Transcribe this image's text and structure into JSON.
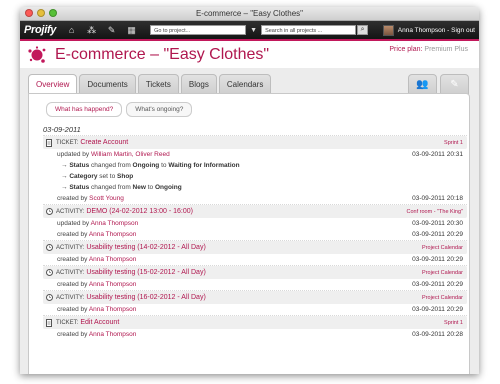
{
  "window": {
    "title": "E-commerce – \"Easy Clothes\""
  },
  "topnav": {
    "logo": "Projify",
    "goto_placeholder": "Go to project...",
    "search_placeholder": "Search in all projects ...",
    "user_name": "Anna Thompson",
    "signout": "Sign out"
  },
  "header": {
    "project_title": "E-commerce – \"Easy Clothes\"",
    "price_label": "Price plan:",
    "price_plan": "Premium Plus"
  },
  "tabs": [
    "Overview",
    "Documents",
    "Tickets",
    "Blogs",
    "Calendars"
  ],
  "subtabs": [
    "What has happend?",
    "What's ongoing?"
  ],
  "feed": {
    "date": "03-09-2011",
    "items": [
      {
        "kind": "TICKET:",
        "title": "Create Account",
        "badge": "Sprint 1",
        "rows": [
          {
            "pre": "updated by ",
            "link": "William Martin, Oliver Reed",
            "ts": "03-09-2011 20:31"
          },
          {
            "change": true,
            "arrow": "→",
            "b1": "Status",
            "t1": " changed from ",
            "b2": "Ongoing",
            "t2": " to ",
            "b3": "Waiting for Information"
          },
          {
            "change": true,
            "arrow": "→",
            "b1": "Category",
            "t1": " set to ",
            "b2": "Shop"
          },
          {
            "change": true,
            "arrow": "→",
            "b1": "Status",
            "t1": " changed from ",
            "b2": "New",
            "t2": " to ",
            "b3": "Ongoing"
          },
          {
            "pre": "created by ",
            "link": "Scott Young",
            "ts": "03-09-2011 20:18"
          }
        ]
      },
      {
        "kind": "ACTIVITY:",
        "title": "DEMO (24-02-2012 13:00 - 16:00)",
        "badge": "Conf room - \"The King\"",
        "rows": [
          {
            "pre": "updated by ",
            "link": "Anna Thompson",
            "ts": "03-09-2011 20:30"
          },
          {
            "pre": "created by ",
            "link": "Anna Thompson",
            "ts": "03-09-2011 20:29"
          }
        ]
      },
      {
        "kind": "ACTIVITY:",
        "title": "Usability testing (14-02-2012 - All Day)",
        "badge": "Project Calendar",
        "rows": [
          {
            "pre": "created by ",
            "link": "Anna Thompson",
            "ts": "03-09-2011 20:29"
          }
        ]
      },
      {
        "kind": "ACTIVITY:",
        "title": "Usability testing (15-02-2012 - All Day)",
        "badge": "Project Calendar",
        "rows": [
          {
            "pre": "created by ",
            "link": "Anna Thompson",
            "ts": "03-09-2011 20:29"
          }
        ]
      },
      {
        "kind": "ACTIVITY:",
        "title": "Usability testing (16-02-2012 - All Day)",
        "badge": "Project Calendar",
        "rows": [
          {
            "pre": "created by ",
            "link": "Anna Thompson",
            "ts": "03-09-2011 20:29"
          }
        ]
      },
      {
        "kind": "TICKET:",
        "title": "Edit Account",
        "badge": "Sprint 1",
        "rows": [
          {
            "pre": "created by ",
            "link": "Anna Thompson",
            "ts": "03-09-2011 20:28"
          }
        ]
      }
    ]
  },
  "colors": {
    "accent": "#b0174f",
    "topbar": "#1e1e1e"
  }
}
